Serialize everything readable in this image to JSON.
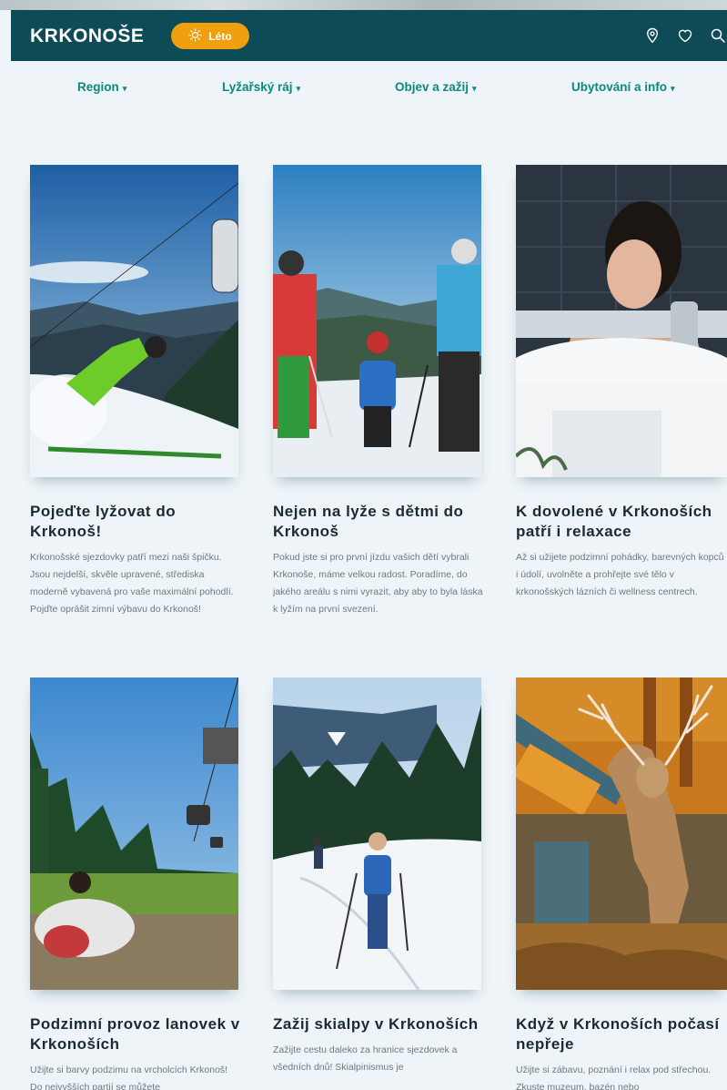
{
  "header": {
    "logo": "KRKONOŠE",
    "season_label": "Léto",
    "icons": [
      "location-pin-icon",
      "heart-icon",
      "search-icon"
    ]
  },
  "nav": {
    "items": [
      {
        "label": "Region"
      },
      {
        "label": "Lyžařský ráj"
      },
      {
        "label": "Objev a zažij"
      },
      {
        "label": "Ubytování a info"
      }
    ]
  },
  "cards": [
    {
      "title": "Pojeďte lyžovat do Krkonoš!",
      "text": "Krkonošské sjezdovky patří mezi naši špičku. Jsou nejdelší, skvěle upravené, střediska moderně vybavená pro vaše maximální pohodlí. Pojďte oprášit zimní výbavu do Krkonoš!"
    },
    {
      "title": "Nejen na lyže s dětmi do Krkonoš",
      "text": "Pokud jste si pro první jízdu vašich dětí vybrali Krkonoše, máme velkou radost. Poradíme, do jakého areálu s nimi vyrazit, aby aby to byla láska k lyžím na první svezení."
    },
    {
      "title": "K dovolené v Krkonoších patří i relaxace",
      "text": "Až si užijete podzimní pohádky, barevných kopců i údolí, uvolněte a prohřejte své tělo v krkonošských lázních či wellness centrech."
    },
    {
      "title": "Podzimní provoz lanovek v Krkonoších",
      "text": "Užijte si barvy podzimu na vrcholcích Krkonoš! Do nejvyšších partií se můžete"
    },
    {
      "title": "Zažij skialpy v Krkonoších",
      "text": "Zažijte cestu daleko za hranice sjezdovek a všedních dnů! Skialpinismus je"
    },
    {
      "title": "Když v Krkonoších počasí nepřeje",
      "text": "Užijte si zábavu, poznání i relax pod střechou. Zkuste muzeum, bazén nebo"
    }
  ],
  "colors": {
    "header_bg": "#0d4b57",
    "accent": "#f0a00f",
    "nav_text": "#0c8a7e",
    "page_bg": "#eef4f7"
  }
}
